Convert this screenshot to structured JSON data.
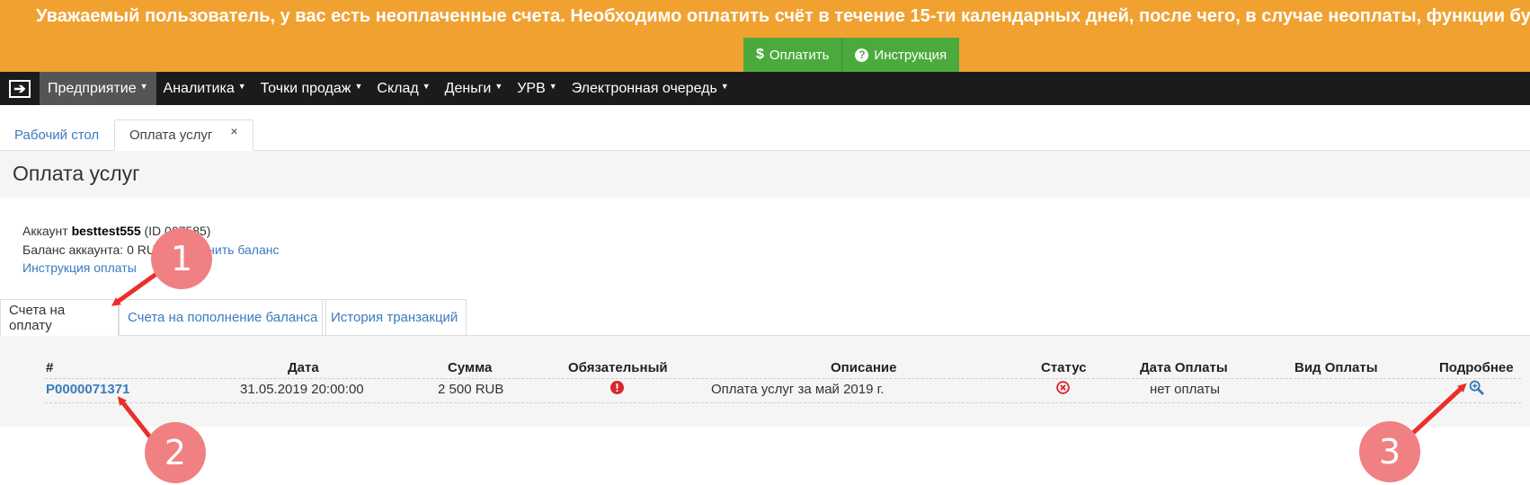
{
  "banner": {
    "text": "Уважаемый пользователь, у вас есть неоплаченные счета. Необходимо оплатить счёт в течение 15-ти календарных дней, после чего, в случае неоплаты, функции бу",
    "pay_label": "Оплатить",
    "instruction_label": "Инструкция"
  },
  "nav": {
    "items": [
      "Предприятие",
      "Аналитика",
      "Точки продаж",
      "Склад",
      "Деньги",
      "УРВ",
      "Электронная очередь"
    ]
  },
  "tabs": {
    "desktop": "Рабочий стол",
    "active": "Оплата услуг",
    "close": "×"
  },
  "page": {
    "title": "Оплата услуг"
  },
  "account": {
    "label": "Аккаунт",
    "name": "besttest555",
    "id": "(ID 007585)",
    "balance_text": "Баланс аккаунта: 0 RUB.",
    "topup_link": "Пополнить баланс",
    "instruction_link": "Инструкция оплаты"
  },
  "subtabs": [
    "Счета на оплату",
    "Счета на пополнение баланса",
    "История транзакций"
  ],
  "table": {
    "headers": [
      "#",
      "Дата",
      "Сумма",
      "Обязательный",
      "Описание",
      "Статус",
      "Дата Оплаты",
      "Вид Оплаты",
      "Подробнее"
    ],
    "rows": [
      {
        "number": "P0000071371",
        "date": "31.05.2019 20:00:00",
        "amount": "2 500 RUB",
        "required_icon": "exclamation-circle-icon",
        "description": "Оплата услуг за май 2019 г.",
        "status_icon": "times-circle-icon",
        "paid_date": "нет оплаты",
        "pay_type": "",
        "details_icon": "zoom-in-icon"
      }
    ]
  },
  "annotations": {
    "labels": [
      "1",
      "2",
      "3"
    ],
    "color": "#f08082",
    "arrow_color": "#e8302a"
  },
  "colors": {
    "banner": "#f0a130",
    "button": "#4caa3c",
    "nav": "#1b1b1b",
    "nav_active": "#555555",
    "link": "#3a7bbf",
    "error": "#d9262c"
  }
}
